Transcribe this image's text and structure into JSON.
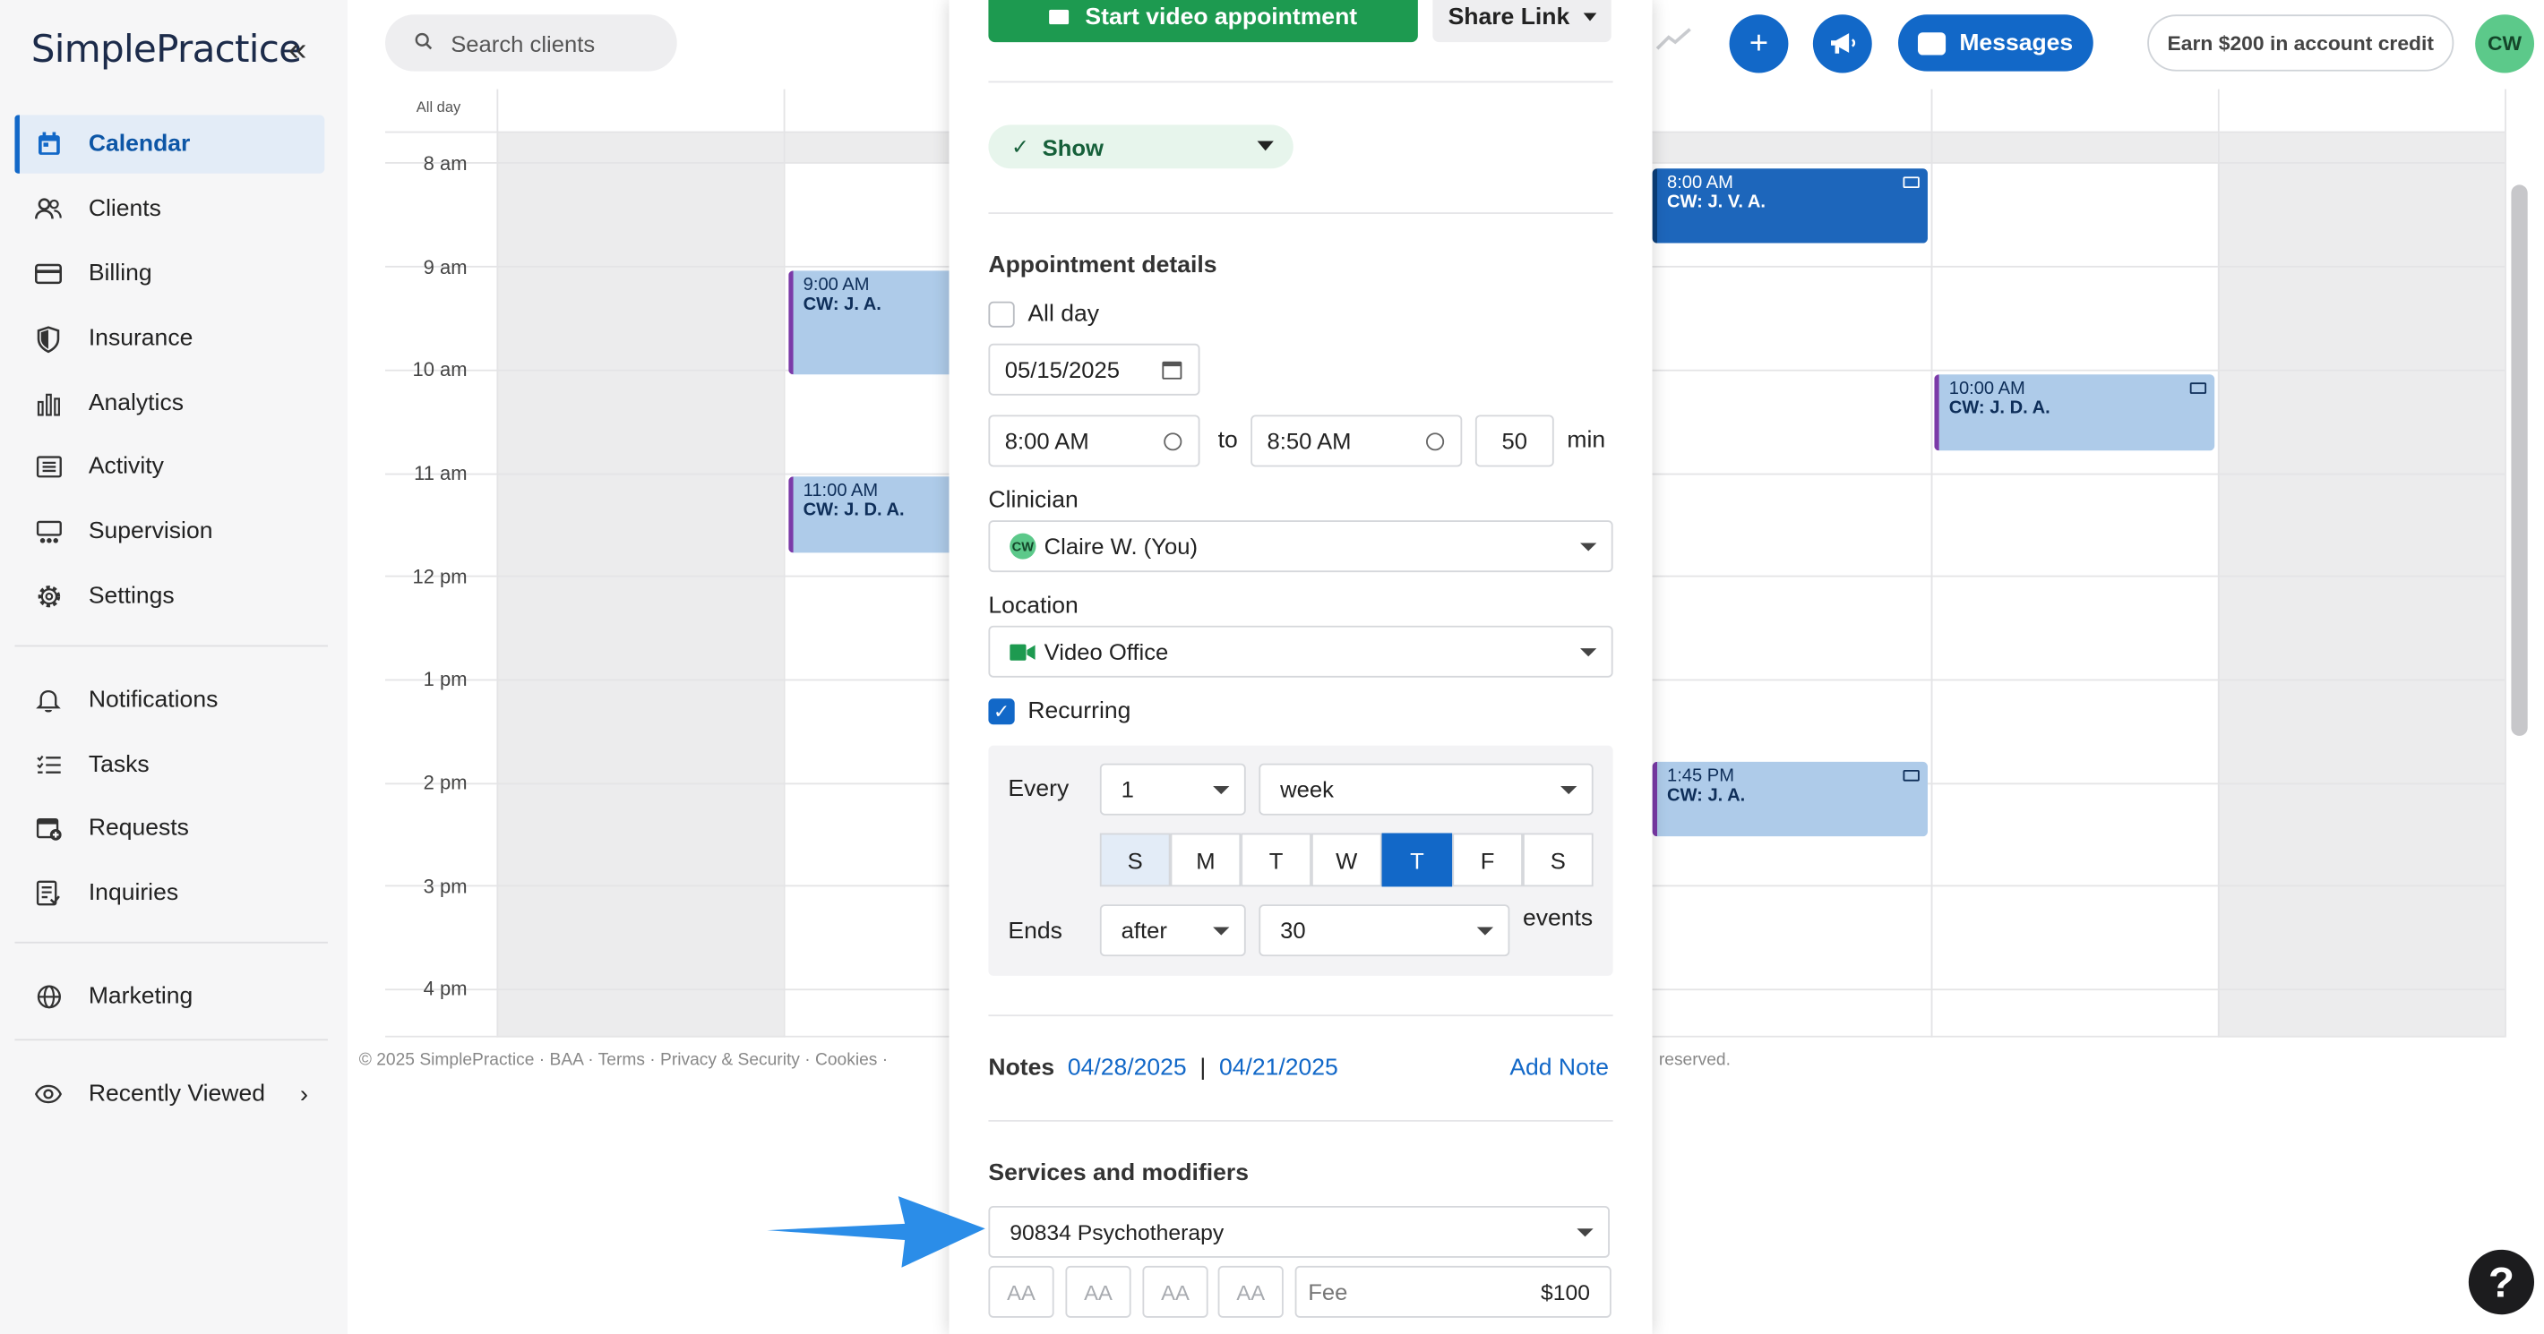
{
  "app": {
    "logo": "SimplePractice",
    "collapse_glyph": "«"
  },
  "sidebar": {
    "items": [
      {
        "label": "Calendar",
        "icon": "calendar-icon"
      },
      {
        "label": "Clients",
        "icon": "users-icon"
      },
      {
        "label": "Billing",
        "icon": "credit-card-icon"
      },
      {
        "label": "Insurance",
        "icon": "shield-icon"
      },
      {
        "label": "Analytics",
        "icon": "bar-chart-icon"
      },
      {
        "label": "Activity",
        "icon": "list-icon"
      },
      {
        "label": "Supervision",
        "icon": "supervision-icon"
      },
      {
        "label": "Settings",
        "icon": "gear-icon"
      },
      {
        "label": "Notifications",
        "icon": "bell-icon"
      },
      {
        "label": "Tasks",
        "icon": "tasks-icon"
      },
      {
        "label": "Requests",
        "icon": "calendar-plus-icon"
      },
      {
        "label": "Inquiries",
        "icon": "clipboard-icon"
      },
      {
        "label": "Marketing",
        "icon": "globe-icon"
      }
    ],
    "recently_viewed": "Recently Viewed"
  },
  "topbar": {
    "search_placeholder": "Search clients",
    "messages_label": "Messages",
    "earn_label": "Earn $200 in account credit",
    "avatar_initials": "CW",
    "plus_glyph": "+"
  },
  "calendar": {
    "allday_label": "All day",
    "times": [
      "8 am",
      "9 am",
      "10 am",
      "11 am",
      "12 pm",
      "1 pm",
      "2 pm",
      "3 pm",
      "4 pm"
    ],
    "events": [
      {
        "time": "9:00 AM",
        "name": "CW: J. A."
      },
      {
        "time": "11:00 AM",
        "name": "CW: J. D. A."
      },
      {
        "time": "8:00 AM",
        "name": "CW: J. V. A."
      },
      {
        "time": "10:00 AM",
        "name": "CW: J. D. A."
      },
      {
        "time": "1:45 PM",
        "name": "CW: J. A."
      }
    ],
    "footer_left": "© 2025 SimplePractice · BAA · Terms · Privacy & Security · Cookies ·",
    "footer_right": "reserved."
  },
  "panel": {
    "start_video": "Start video appointment",
    "share_link": "Share Link",
    "status": "Show",
    "details_title": "Appointment details",
    "all_day_label": "All day",
    "date": "05/15/2025",
    "start_time": "8:00 AM",
    "to_label": "to",
    "end_time": "8:50 AM",
    "duration": "50",
    "duration_unit": "min",
    "clinician_label": "Clinician",
    "clinician_badge": "CW",
    "clinician": "Claire W. (You)",
    "location_label": "Location",
    "location": "Video Office",
    "recurring_label": "Recurring",
    "every_label": "Every",
    "every_value": "1",
    "every_unit": "week",
    "days": [
      "S",
      "M",
      "T",
      "W",
      "T",
      "F",
      "S"
    ],
    "ends_label": "Ends",
    "ends_mode": "after",
    "ends_count": "30",
    "events_label": "events",
    "notes_label": "Notes",
    "note_dates": [
      "04/28/2025",
      "04/21/2025"
    ],
    "note_sep": "|",
    "add_note": "Add Note",
    "services_title": "Services and modifiers",
    "service": "90834 Psychotherapy",
    "modifiers": [
      "AA",
      "AA",
      "AA",
      "AA"
    ],
    "fee_label": "Fee",
    "fee_value": "$100"
  },
  "help_glyph": "?",
  "colors": {
    "brand_blue": "#1268c8",
    "video_green": "#1d9a50",
    "event_light": "#aecbe9",
    "event_dark": "#1d66bb"
  }
}
